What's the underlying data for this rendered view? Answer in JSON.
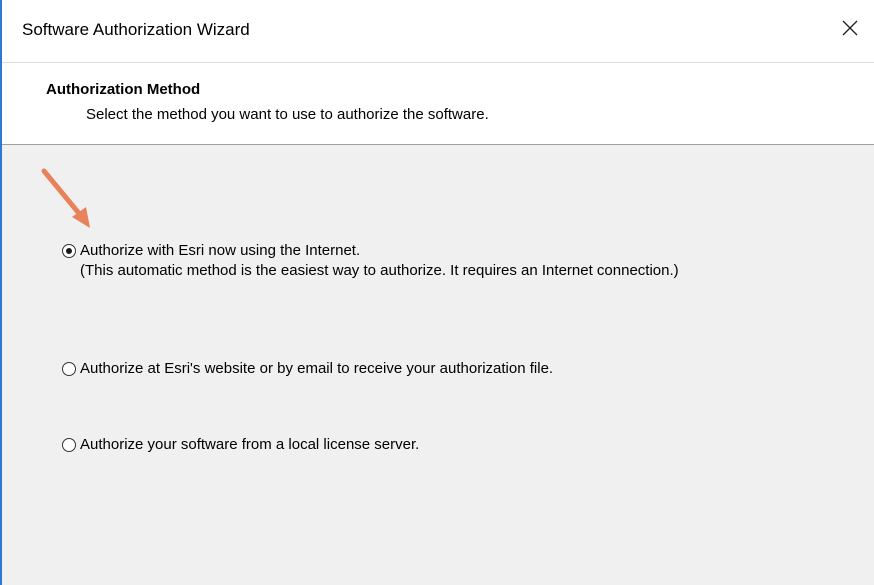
{
  "window": {
    "title": "Software Authorization Wizard",
    "close_icon": "close-icon",
    "accent_color": "#2b79d0"
  },
  "header": {
    "title": "Authorization Method",
    "subtitle": "Select the method you want to use to authorize the software."
  },
  "options": [
    {
      "label": "Authorize with Esri now using the Internet.",
      "description": "(This automatic method is the easiest way to authorize. It requires an Internet connection.)",
      "selected": true
    },
    {
      "label": "Authorize at Esri's website or by email to receive your authorization file.",
      "selected": false
    },
    {
      "label": "Authorize your software from a local license server.",
      "selected": false
    }
  ],
  "annotation": {
    "icon": "arrow-icon",
    "color": "#e8825a"
  }
}
